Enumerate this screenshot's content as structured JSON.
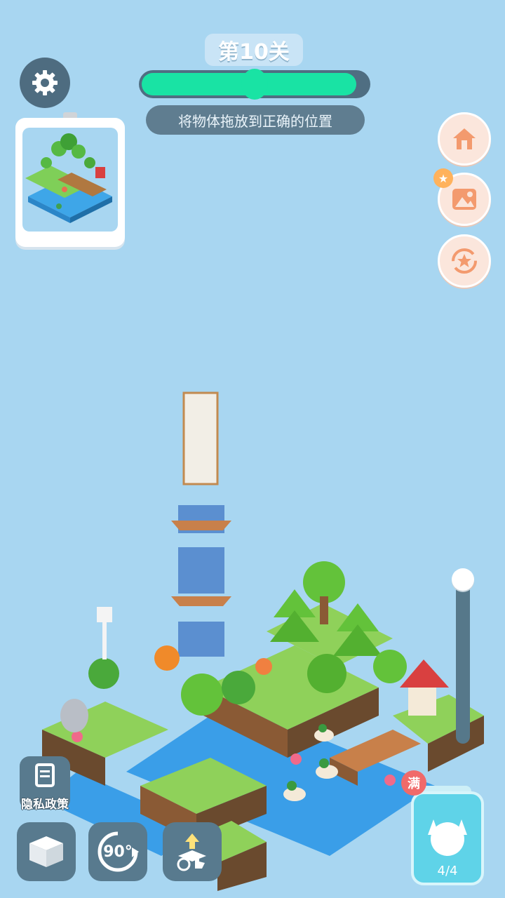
{
  "header": {
    "level_title": "第10关",
    "progress_fraction": 0.95,
    "progress_marker_fraction": 0.5,
    "hint": "将物体拖放到正确的位置"
  },
  "left_panel": {
    "settings_icon": "gear-icon",
    "preview_label": "level-preview"
  },
  "right_buttons": [
    {
      "icon": "home-icon"
    },
    {
      "icon": "gallery-icon",
      "badge": "star-icon"
    },
    {
      "icon": "star-refresh-icon"
    }
  ],
  "bottom_bar": {
    "privacy_label": "隐私政策",
    "privacy_icon": "document-icon",
    "box_icon": "box-icon",
    "rotate_label": "90°",
    "rotate_icon": "rotate-icon",
    "hint_icon": "tap-hint-icon"
  },
  "jar": {
    "badge": "满",
    "count": "4/4",
    "icon": "cat-icon"
  },
  "colors": {
    "background": "#a8d6f1",
    "progress": "#19e3a4",
    "dark_ui": "#587a8e",
    "accent_button": "#fbe6dc"
  }
}
